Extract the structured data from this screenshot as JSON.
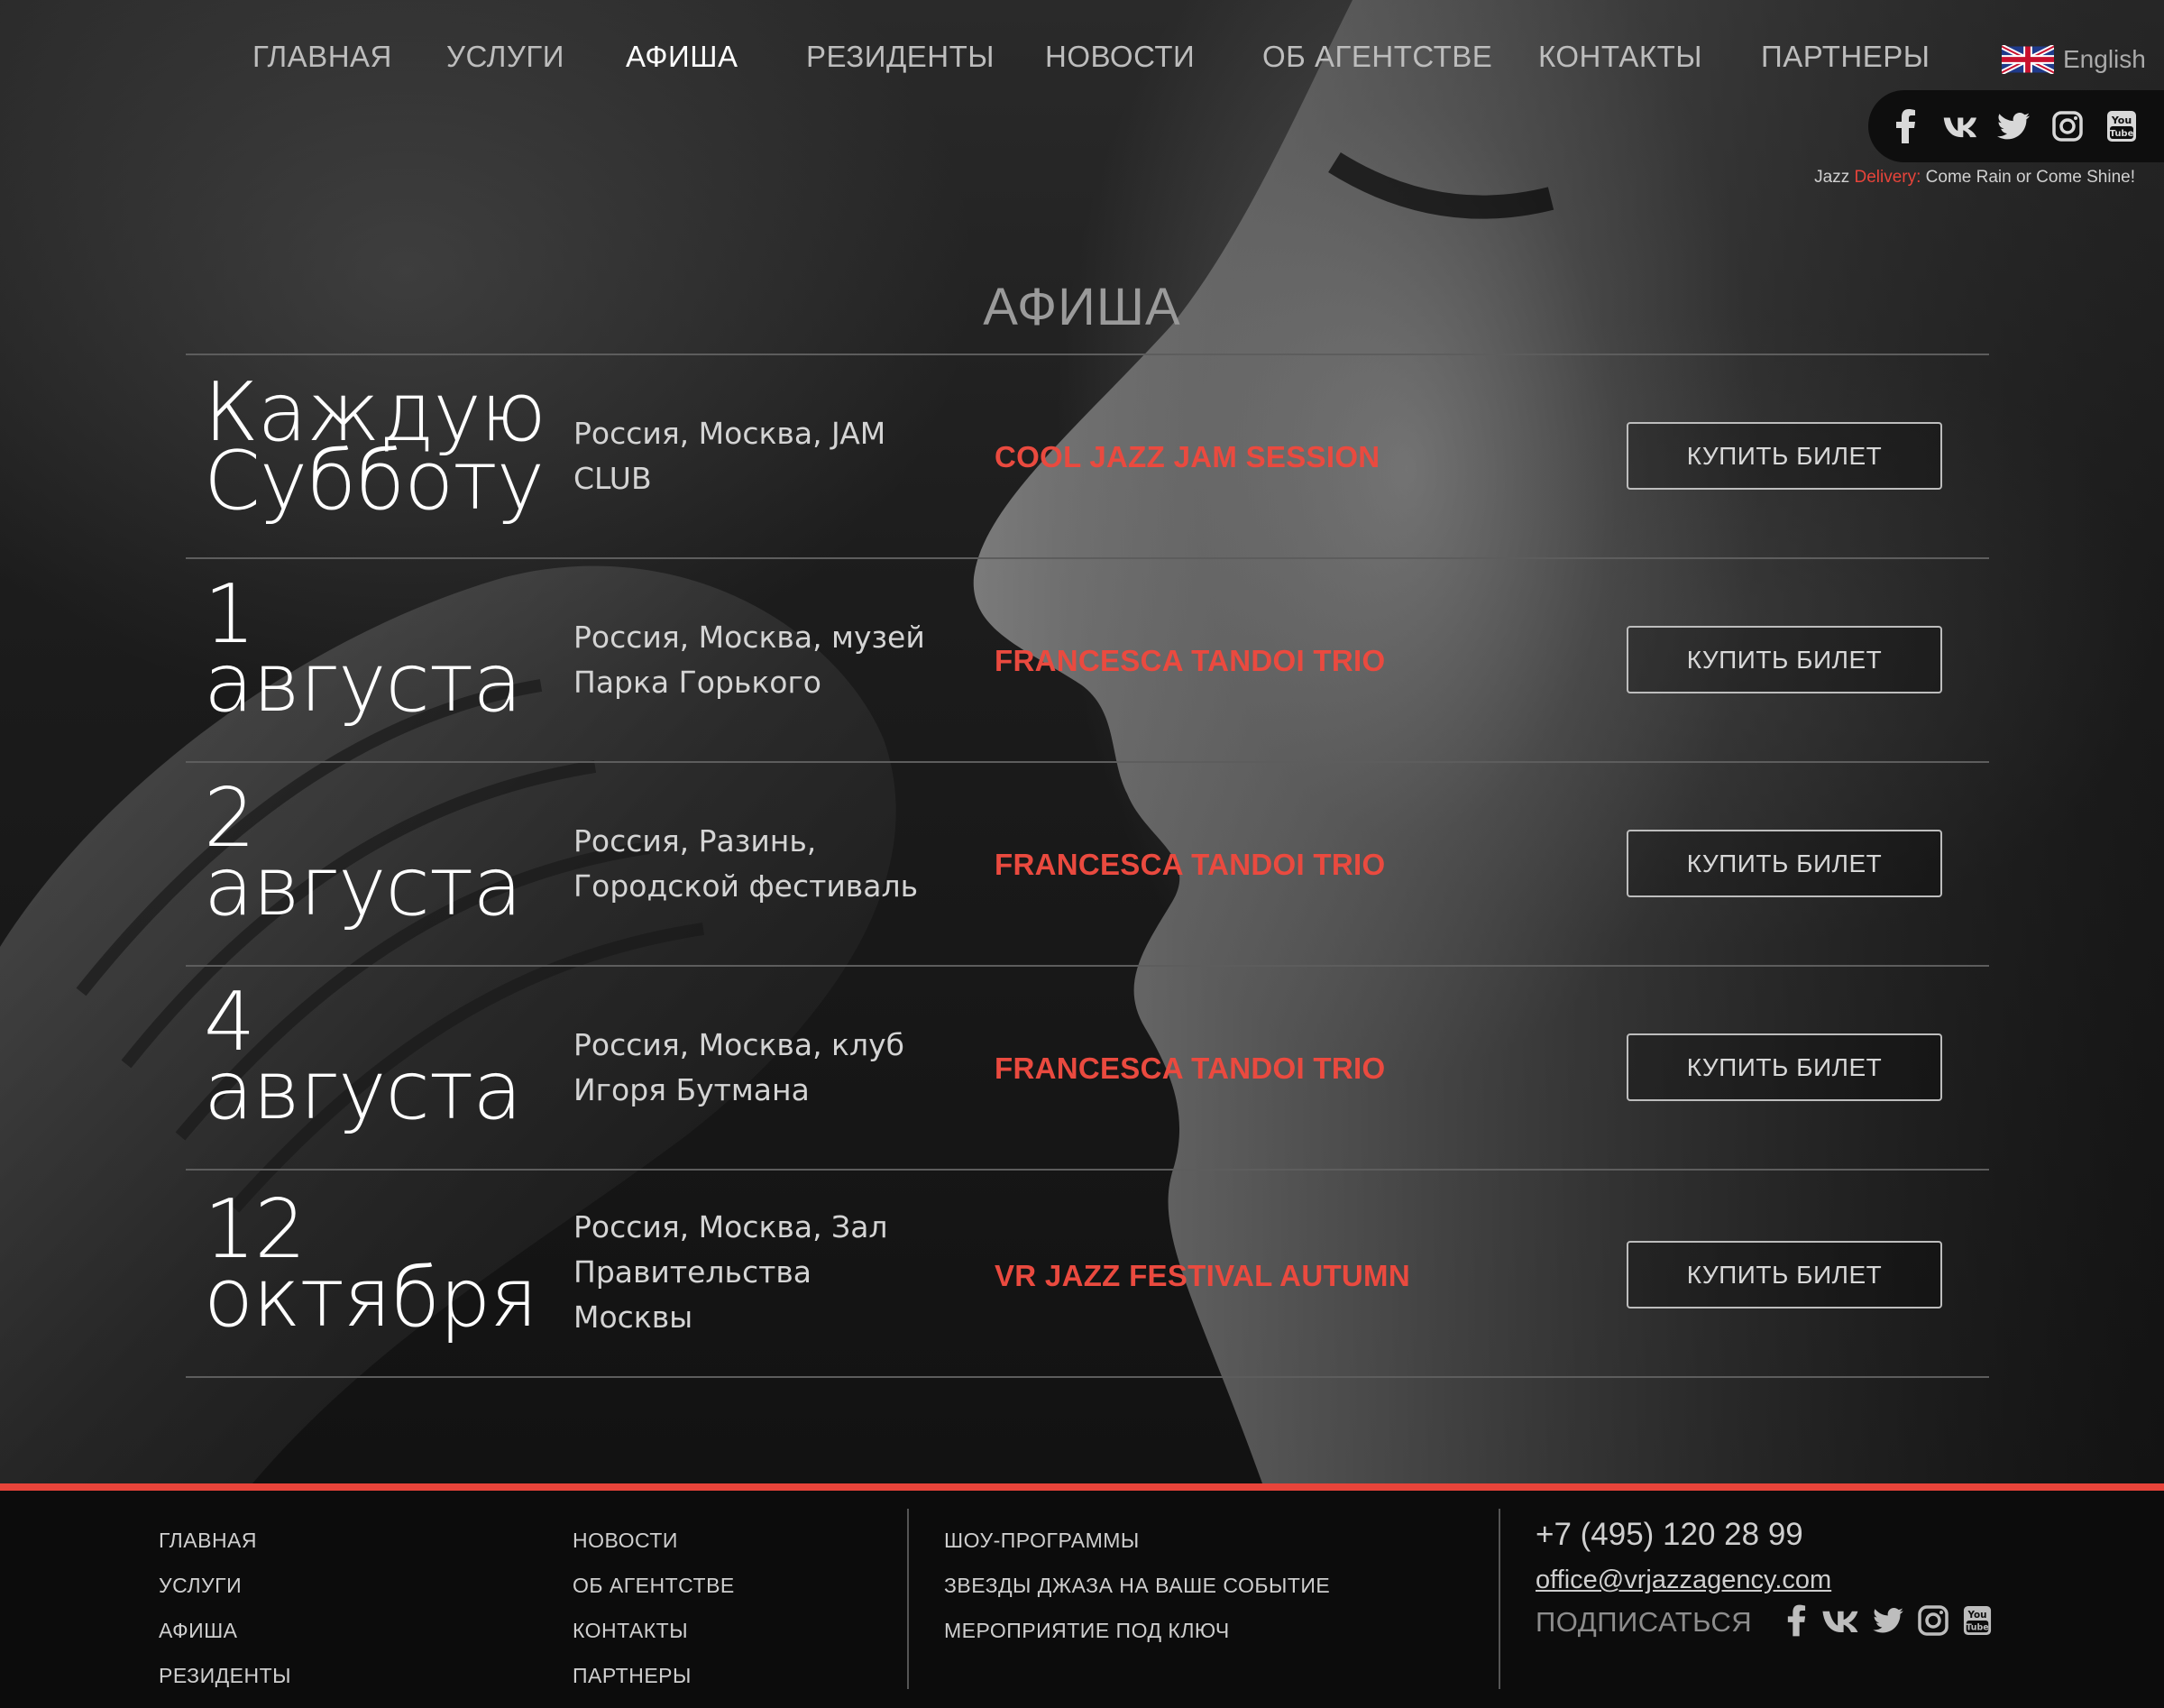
{
  "nav": {
    "items": [
      {
        "label": "ГЛАВНАЯ",
        "active": false
      },
      {
        "label": "УСЛУГИ",
        "active": false
      },
      {
        "label": "АФИША",
        "active": true
      },
      {
        "label": "РЕЗИДЕНТЫ",
        "active": false
      },
      {
        "label": "НОВОСТИ",
        "active": false
      },
      {
        "label": "ОБ АГЕНТСТВЕ",
        "active": false
      },
      {
        "label": "КОНТАКТЫ",
        "active": false
      },
      {
        "label": "ПАРТНЕРЫ",
        "active": false
      }
    ],
    "language": "English"
  },
  "social": [
    "facebook-icon",
    "vk-icon",
    "twitter-icon",
    "instagram-icon",
    "youtube-icon"
  ],
  "tagline": {
    "prefix": "Jazz ",
    "accent": "Delivery:",
    "suffix": " Come Rain or Come Shine!"
  },
  "page": {
    "title": "АФИША"
  },
  "events": [
    {
      "date_line1": "Каждую",
      "date_line2": "Субботу",
      "place": "Россия, Москва, JAM CLUB",
      "title": "COOL JAZZ JAM SESSION",
      "button": "КУПИТЬ БИЛЕТ"
    },
    {
      "date_line1": "1",
      "date_line2": "августа",
      "place": "Россия, Москва, музей Парка Горького",
      "title": "FRANCESCA TANDOI TRIO",
      "button": "КУПИТЬ БИЛЕТ"
    },
    {
      "date_line1": "2",
      "date_line2": "августа",
      "place": "Россия, Разинь, Городской фестиваль",
      "title": "FRANCESCA TANDOI TRIO",
      "button": "КУПИТЬ БИЛЕТ"
    },
    {
      "date_line1": "4",
      "date_line2": "августа",
      "place": "Россия, Москва, клуб Игоря Бутмана",
      "title": "FRANCESCA TANDOI TRIO",
      "button": "КУПИТЬ БИЛЕТ"
    },
    {
      "date_line1": "12",
      "date_line2": "октября",
      "place": "Россия, Москва, Зал Правительства Москвы",
      "title": "VR JAZZ FESTIVAL AUTUMN",
      "button": "КУПИТЬ БИЛЕТ"
    }
  ],
  "footer": {
    "col1": [
      "ГЛАВНАЯ",
      "УСЛУГИ",
      "АФИША",
      "РЕЗИДЕНТЫ"
    ],
    "col2": [
      "НОВОСТИ",
      "ОБ АГЕНТСТВЕ",
      "КОНТАКТЫ",
      "ПАРТНЕРЫ"
    ],
    "col3": [
      "ШОУ-ПРОГРАММЫ",
      "ЗВЕЗДЫ ДЖАЗА НА ВАШЕ СОБЫТИЕ",
      "МЕРОПРИЯТИЕ ПОД КЛЮЧ"
    ],
    "phone": "+7 (495) 120 28 99",
    "email": "office@vrjazzagency.com",
    "subscribe": "ПОДПИСАТЬСЯ"
  },
  "colors": {
    "accent": "#e8443a",
    "background": "#111111",
    "footer": "#0c0c0c"
  }
}
